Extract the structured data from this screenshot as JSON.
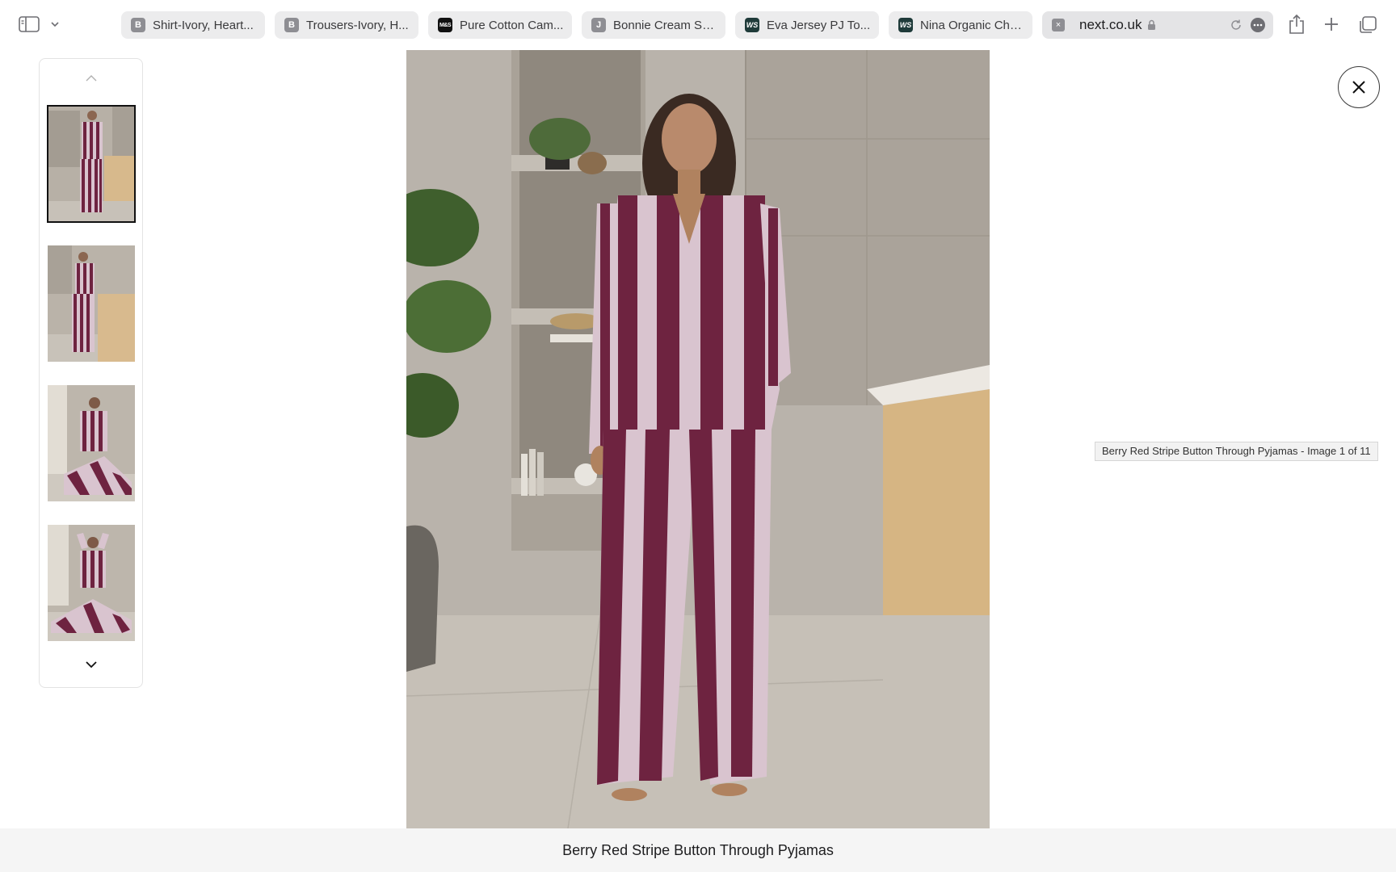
{
  "browser": {
    "tabs": [
      {
        "label": "Shirt-Ivory, Heart...",
        "favicon_text": "B",
        "favicon": "b-icon"
      },
      {
        "label": "Trousers-Ivory, H...",
        "favicon_text": "B",
        "favicon": "b-icon"
      },
      {
        "label": "Pure Cotton Cam...",
        "favicon_text": "M&S",
        "favicon": "ms-icon"
      },
      {
        "label": "Bonnie Cream Sa...",
        "favicon_text": "J",
        "favicon": "j-icon"
      },
      {
        "label": "Eva Jersey PJ To...",
        "favicon_text": "WS",
        "favicon": "ws-icon"
      },
      {
        "label": "Nina Organic Che...",
        "favicon_text": "WS",
        "favicon": "ws-icon"
      }
    ],
    "active_tab": {
      "url": "next.co.uk",
      "favicon_text": "×"
    }
  },
  "viewer": {
    "tooltip": "Berry Red Stripe Button Through Pyjamas - Image 1 of 11",
    "caption": "Berry Red Stripe Button Through Pyjamas",
    "thumbnails_visible": 4,
    "selected_thumbnail": 1
  },
  "colors": {
    "stripe_berry": "#6e2340",
    "stripe_light": "#d9c4cf",
    "wall": "#b8b2aa",
    "floor": "#c9c3bb",
    "counter": "#d8b98c"
  }
}
